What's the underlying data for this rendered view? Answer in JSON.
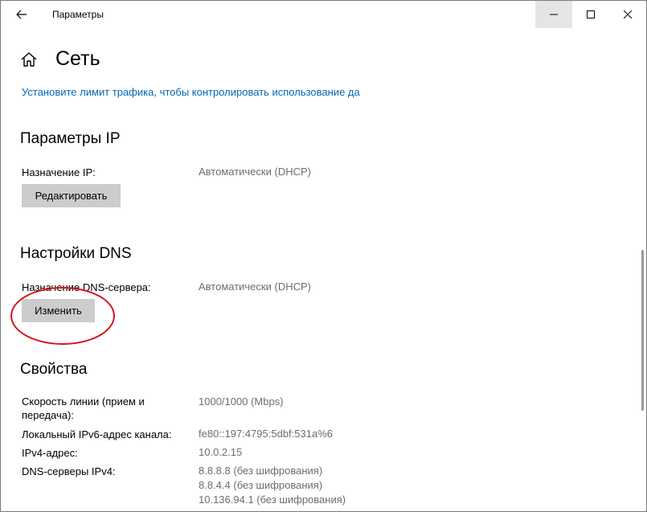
{
  "titlebar": {
    "title": "Параметры",
    "back_icon": "arrow-left-icon",
    "controls": [
      "minimize-icon",
      "maximize-icon",
      "close-icon"
    ]
  },
  "header": {
    "home_icon": "home-icon",
    "title": "Сеть"
  },
  "data_limit_link": "Установите лимит трафика, чтобы контролировать использование да",
  "ip_section": {
    "title": "Параметры IP",
    "assignment_label": "Назначение IP:",
    "assignment_value": "Автоматически (DHCP)",
    "edit_button": "Редактировать"
  },
  "dns_section": {
    "title": "Настройки DNS",
    "assignment_label": "Назначение DNS-сервера:",
    "assignment_value": "Автоматически (DHCP)",
    "edit_button": "Изменить",
    "highlight_color": "#d4141b"
  },
  "properties": {
    "title": "Свойства",
    "link_speed_label_1": "Скорость линии (прием и",
    "link_speed_label_2": "передача):",
    "link_speed_value": "1000/1000 (Mbps)",
    "ipv6_label": "Локальный IPv6-адрес канала:",
    "ipv6_value": "fe80::197:4795:5dbf:531a%6",
    "ipv4_label": "IPv4-адрес:",
    "ipv4_value": "10.0.2.15",
    "dns_label": "DNS-серверы IPv4:",
    "dns_values": [
      "8.8.8.8 (без шифрования)",
      "8.8.4.4 (без шифрования)",
      "10.136.94.1 (без шифрования)"
    ]
  },
  "colors": {
    "accent_link": "#0067b8",
    "button_bg": "#cccccc",
    "value_text": "#6d6d6d"
  }
}
